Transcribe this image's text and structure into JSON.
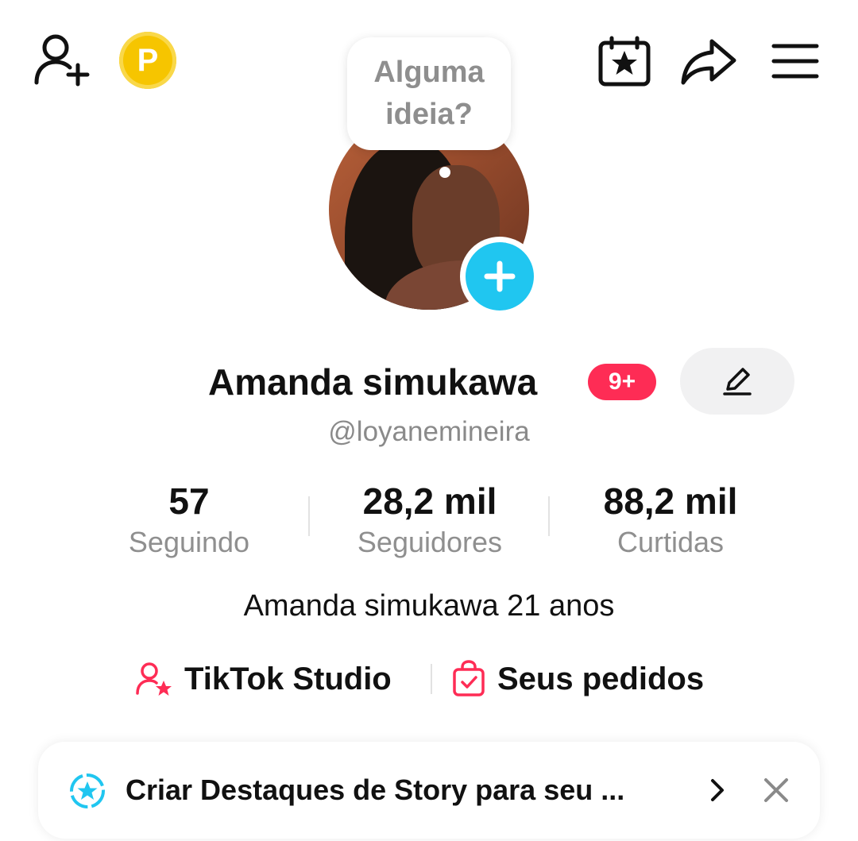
{
  "topbar": {
    "coin_letter": "P",
    "icons": [
      "add-friend-icon",
      "coin-icon",
      "calendar-star-icon",
      "share-icon",
      "menu-icon"
    ]
  },
  "bubble": {
    "line1": "Alguma",
    "line2": "ideia?"
  },
  "profile": {
    "display_name": "Amanda simukawa",
    "notification_badge": "9+",
    "username": "@loyanemineira",
    "bio": "Amanda simukawa 21 anos"
  },
  "stats": [
    {
      "value": "57",
      "label": "Seguindo"
    },
    {
      "value": "28,2 mil",
      "label": "Seguidores"
    },
    {
      "value": "88,2 mil",
      "label": "Curtidas"
    }
  ],
  "links": {
    "studio": "TikTok Studio",
    "orders": "Seus pedidos"
  },
  "banner": {
    "text": "Criar Destaques de Story para seu ..."
  },
  "colors": {
    "accent_pink": "#fe2c55",
    "accent_cyan": "#20c6f0",
    "coin": "#f6c500"
  }
}
